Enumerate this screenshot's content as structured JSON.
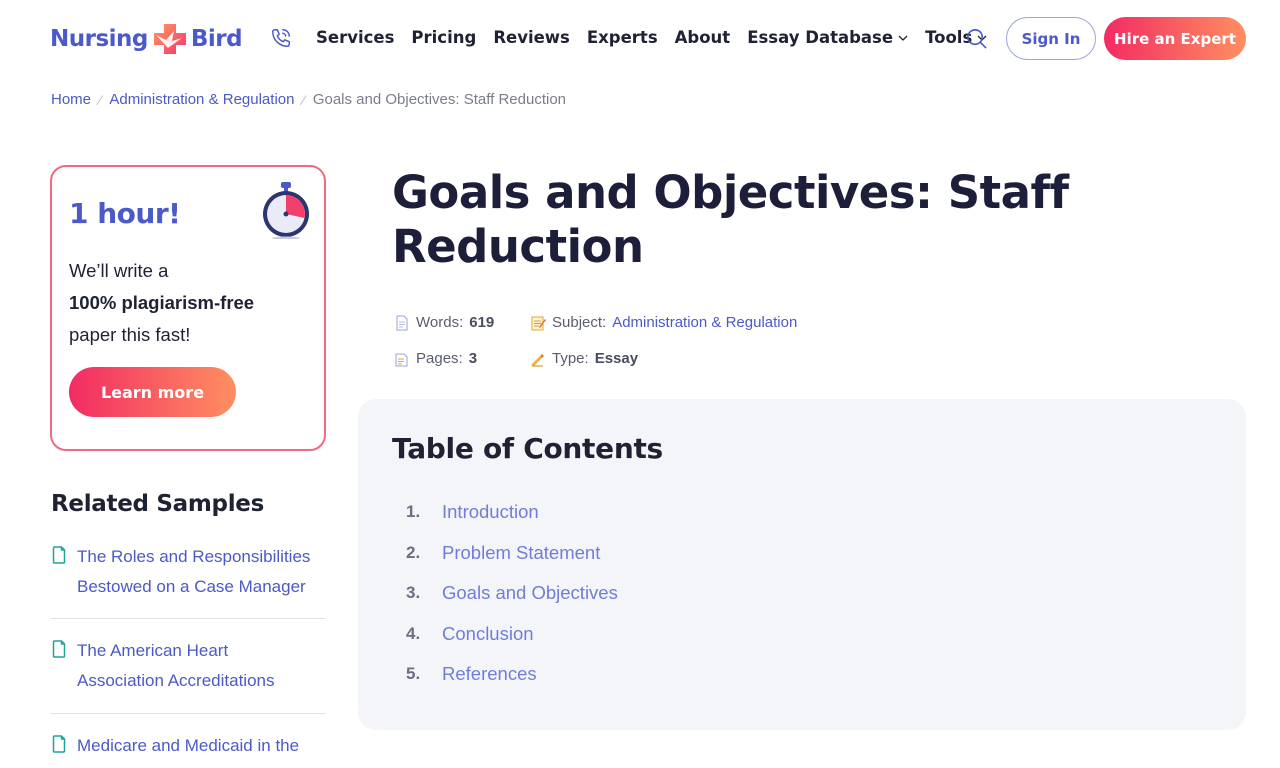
{
  "header": {
    "logo": {
      "left": "Nursing",
      "right": "Bird"
    },
    "nav": [
      {
        "label": "Services",
        "dropdown": false
      },
      {
        "label": "Pricing",
        "dropdown": false
      },
      {
        "label": "Reviews",
        "dropdown": false
      },
      {
        "label": "Experts",
        "dropdown": false
      },
      {
        "label": "About",
        "dropdown": false
      },
      {
        "label": "Essay Database",
        "dropdown": true
      },
      {
        "label": "Tools",
        "dropdown": true
      }
    ],
    "sign_in": "Sign In",
    "hire": "Hire an Expert"
  },
  "breadcrumb": {
    "home": "Home",
    "category": "Administration & Regulation",
    "current": "Goals and Objectives: Staff Reduction"
  },
  "promo": {
    "title": "1 hour!",
    "line1": "We’ll write a",
    "line2": "100% plagiarism-free",
    "line3": "paper this fast!",
    "button": "Learn more"
  },
  "related": {
    "title": "Related Samples",
    "items": [
      {
        "line1": "The Roles and Responsibilities",
        "line2": "Bestowed on a Case Manager"
      },
      {
        "line1": "The American Heart",
        "line2": "Association Accreditations"
      },
      {
        "line1": "Medicare and Medicaid in the",
        "line2": ""
      }
    ]
  },
  "article": {
    "title": "Goals and Objectives: Staff Reduction",
    "meta": {
      "words_label": "Words:",
      "words": "619",
      "subject_label": "Subject:",
      "subject": "Administration & Regulation",
      "pages_label": "Pages:",
      "pages": "3",
      "type_label": "Type:",
      "type": "Essay"
    }
  },
  "toc": {
    "title": "Table of Contents",
    "items": [
      {
        "num": "1.",
        "label": "Introduction"
      },
      {
        "num": "2.",
        "label": "Problem Statement"
      },
      {
        "num": "3.",
        "label": "Goals and Objectives"
      },
      {
        "num": "4.",
        "label": "Conclusion"
      },
      {
        "num": "5.",
        "label": "References"
      }
    ]
  },
  "colors": {
    "brand": "#4b59c9",
    "accent_start": "#f22b63",
    "accent_end": "#ff8f61",
    "toc_bg": "#f4f5f9"
  },
  "icons": {
    "phone": "phone-icon",
    "search": "search-icon",
    "timer": "stopwatch-icon",
    "doc": "document-icon"
  }
}
